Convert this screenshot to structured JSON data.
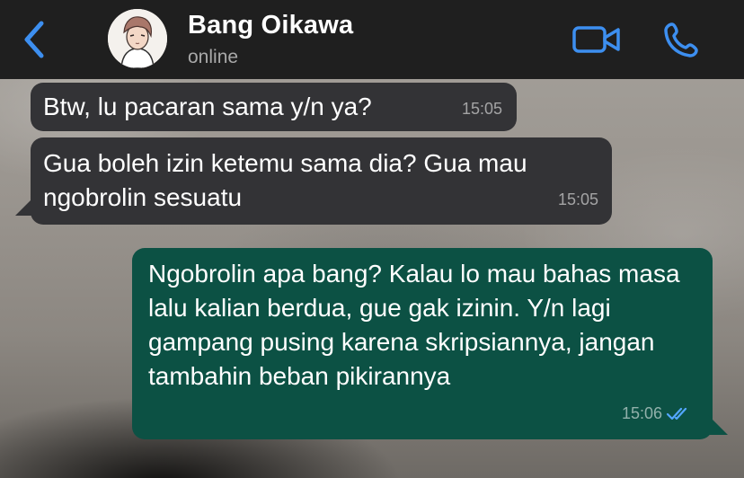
{
  "header": {
    "contact_name": "Bang Oikawa",
    "status": "online",
    "icons": [
      "chevron-left-icon",
      "video-camera-icon",
      "phone-icon"
    ],
    "accent_color": "#3d8ff0"
  },
  "messages": [
    {
      "direction": "incoming",
      "text": "Btw, lu pacaran sama y/n ya?",
      "time": "15:05"
    },
    {
      "direction": "incoming",
      "text": "Gua boleh izin ketemu sama dia? Gua mau ngobrolin sesuatu",
      "time": "15:05"
    },
    {
      "direction": "outgoing",
      "text": "Ngobrolin apa bang? Kalau lo mau bahas masa lalu kalian berdua, gue gak izinin. Y/n lagi gampang pusing karena skripsiannya, jangan tambahin beban pikirannya",
      "time": "15:06",
      "read_receipt": "double-check-icon"
    }
  ],
  "colors": {
    "incoming_bubble": "#333336",
    "outgoing_bubble": "#0c5144",
    "header_bg": "#1f1f1f"
  }
}
